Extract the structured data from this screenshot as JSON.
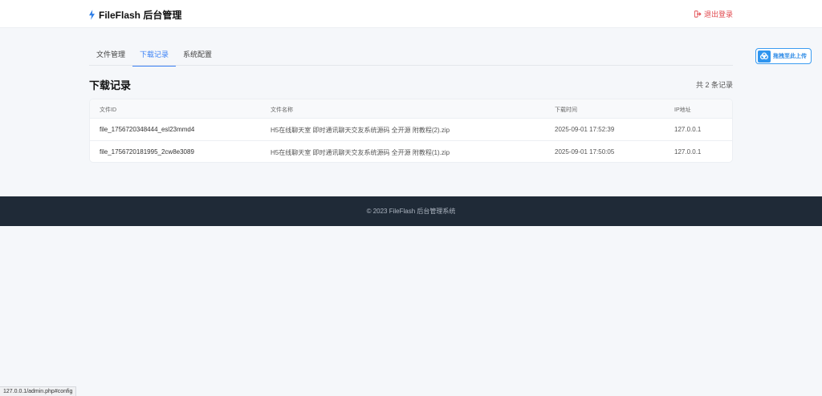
{
  "header": {
    "brand": "FileFlash 后台管理",
    "logout_label": "退出登录"
  },
  "tabs": [
    {
      "label": "文件管理",
      "active": false
    },
    {
      "label": "下载记录",
      "active": true
    },
    {
      "label": "系统配置",
      "active": false
    }
  ],
  "section": {
    "title": "下载记录",
    "count": "共 2 条记录"
  },
  "table": {
    "headers": [
      "文件ID",
      "文件名称",
      "下载时间",
      "IP地址"
    ],
    "rows": [
      [
        "file_1756720348444_esl23mmd4",
        "H5在线聊天室 即时通讯聊天交友系统源码 全开源 附教程(2).zip",
        "2025-09-01 17:52:39",
        "127.0.0.1"
      ],
      [
        "file_1756720181995_2cw8e3089",
        "H5在线聊天室 即时通讯聊天交友系统源码 全开源 附教程(1).zip",
        "2025-09-01 17:50:05",
        "127.0.0.1"
      ]
    ]
  },
  "footer": {
    "text": "© 2023 FileFlash 后台管理系统"
  },
  "float_button": {
    "label": "拖拽至此上传",
    "icon": "cloud-icon"
  },
  "statusbar": {
    "url": "127.0.0.1/admin.php#config"
  },
  "colors": {
    "accent": "#3b82f6",
    "logout": "#e0474c",
    "footer_bg": "#1f2a37"
  }
}
